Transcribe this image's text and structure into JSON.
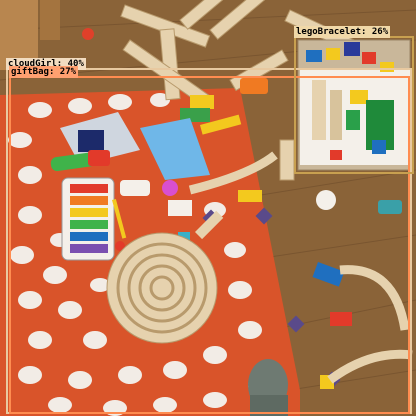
{
  "image": {
    "description_colors": {
      "floor": "#8a6338",
      "rug": "#d9542a",
      "rug_dots": "#f2ece6",
      "wood_track": "#e6d2ae"
    }
  },
  "detections": [
    {
      "label": "legoBracelet",
      "score": "26%",
      "color": "#c8a050"
    },
    {
      "label": "cloudGirl",
      "score": "40%",
      "color": "#e8c9a0"
    },
    {
      "label": "giftBag",
      "score": "27%",
      "color": "#ff8c50"
    }
  ]
}
